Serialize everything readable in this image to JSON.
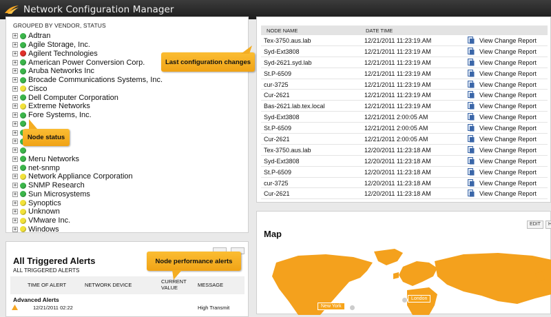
{
  "window": {
    "title": "Network Configuration Manager"
  },
  "vendors": {
    "header": "GROUPED BY VENDOR, STATUS",
    "items": [
      {
        "label": "Adtran",
        "status": "#3bb54a"
      },
      {
        "label": "Agile Storage, Inc.",
        "status": "#3bb54a"
      },
      {
        "label": "Agilent Technologies",
        "status": "#e0302b"
      },
      {
        "label": "American Power Conversion Corp.",
        "status": "#3bb54a"
      },
      {
        "label": "Aruba Networks Inc",
        "status": "#3bb54a"
      },
      {
        "label": "Brocade Communications Systems, Inc.",
        "status": "#3bb54a"
      },
      {
        "label": "Cisco",
        "status": "#f2e23a"
      },
      {
        "label": "Dell Computer Corporation",
        "status": "#3bb54a"
      },
      {
        "label": "Extreme Networks",
        "status": "#f2e23a"
      },
      {
        "label": "Fore Systems, Inc.",
        "status": "#3bb54a"
      },
      {
        "label": "",
        "status": "#3bb54a"
      },
      {
        "label": "",
        "status": "#3bb54a"
      },
      {
        "label": "",
        "status": "#3bb54a"
      },
      {
        "label": "",
        "status": "#3bb54a"
      },
      {
        "label": "Meru Networks",
        "status": "#3bb54a"
      },
      {
        "label": "net-snmp",
        "status": "#3bb54a"
      },
      {
        "label": "Network Appliance Corporation",
        "status": "#f2e23a"
      },
      {
        "label": "SNMP Research",
        "status": "#3bb54a"
      },
      {
        "label": "Sun Microsystems",
        "status": "#3bb54a"
      },
      {
        "label": "Synoptics",
        "status": "#f2e23a"
      },
      {
        "label": "Unknown",
        "status": "#f2e23a"
      },
      {
        "label": "VMware Inc.",
        "status": "#f2e23a"
      },
      {
        "label": "Windows",
        "status": "#f2e23a"
      }
    ]
  },
  "changes": {
    "columns": {
      "node": "NODE NAME",
      "date": "DATE TIME"
    },
    "link_label": "View Change Report",
    "rows": [
      {
        "node": "Tex-3750.aus.lab",
        "date": "12/21/2011 11:23:19.AM"
      },
      {
        "node": "Syd-Ext3808",
        "date": "12/21/2011 11:23:19 AM"
      },
      {
        "node": "Syd-2621.syd.lab",
        "date": "12/21/2011 11:23:19 AM"
      },
      {
        "node": "St.P-6509",
        "date": "12/21/2011 11:23:19 AM"
      },
      {
        "node": "cur-3725",
        "date": "12/21/2011 11:23:19 AM"
      },
      {
        "node": "Cur-2621",
        "date": "12/21/2011 11:23:19 AM"
      },
      {
        "node": "Bas-2621.lab.tex.local",
        "date": "12/21/2011 11:23:19 AM"
      },
      {
        "node": "Syd-Ext3808",
        "date": "12/21/2011 2:00:05 AM"
      },
      {
        "node": "St.P-6509",
        "date": "12/21/2011 2:00:05 AM"
      },
      {
        "node": "Cur-2621",
        "date": "12/21/2011 2:00:05 AM"
      },
      {
        "node": "Tex-3750.aus.lab",
        "date": "12/20/2011 11:23:18 AM"
      },
      {
        "node": "Syd-Ext3808",
        "date": "12/20/2011 11:23:18 AM"
      },
      {
        "node": "St.P-6509",
        "date": "12/20/2011 11:23:18 AM"
      },
      {
        "node": "cur-3725",
        "date": "12/20/2011 11:23:18 AM"
      },
      {
        "node": "Cur-2621",
        "date": "12/20/2011 11:23:18 AM"
      }
    ]
  },
  "map": {
    "title": "Map",
    "edit_label": "EDIT",
    "help_label": "H",
    "locations": [
      {
        "label": "New York"
      },
      {
        "label": "London"
      }
    ]
  },
  "alerts": {
    "title": "All Triggered Alerts",
    "subtitle": "ALL TRIGGERED ALERTS",
    "columns": {
      "time": "TIME OF ALERT",
      "device": "NETWORK DEVICE",
      "value": "CURRENT VALUE",
      "message": "MESSAGE"
    },
    "group": "Advanced Alerts",
    "first_row": {
      "time": "12/21/2011 02:22",
      "message": "High Transmit"
    }
  },
  "callouts": {
    "last_config": "Last configuration changes",
    "node_status": "Node status",
    "perf_alerts": "Node performance alerts"
  },
  "colors": {
    "accent": "#f5a623",
    "map_land": "#f4a11d",
    "map_water": "#ffffff"
  }
}
